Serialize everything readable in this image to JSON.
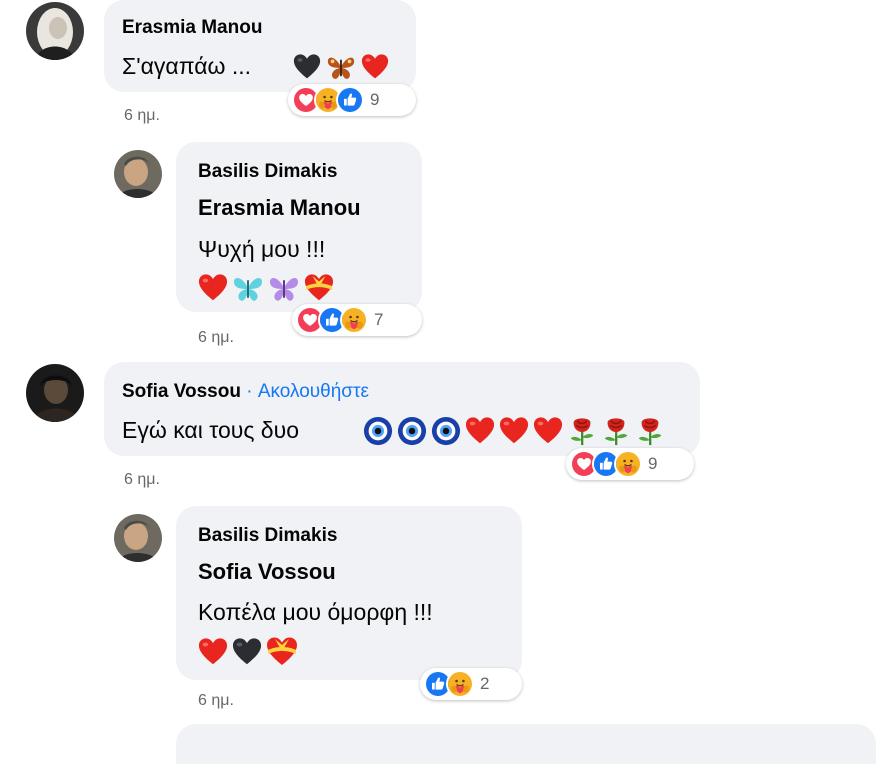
{
  "comments": [
    {
      "author": "Erasmia Manou",
      "text": "Σ'αγαπάω ...",
      "time": "6 ημ.",
      "emojis": [
        "black-heart-icon",
        "butterfly-icon",
        "red-heart-icon"
      ],
      "reactions": [
        "love-icon",
        "care-icon",
        "like-icon"
      ],
      "reaction_count": "9"
    },
    {
      "author": "Basilis Dimakis",
      "mention": "Erasmia Manou",
      "text": "Ψυχή μου !!!",
      "time": "6 ημ.",
      "emojis": [
        "red-heart-icon",
        "blue-butterfly-icon",
        "purple-butterfly-icon",
        "heart-with-ribbon-icon"
      ],
      "reactions": [
        "love-icon",
        "like-icon",
        "care-icon"
      ],
      "reaction_count": "7"
    },
    {
      "author": "Sofia Vossou",
      "follow_label": "· Ακολουθήστε",
      "text": "Εγώ και τους δυο",
      "time": "6 ημ.",
      "emojis": [
        "nazar-amulet-icon",
        "nazar-amulet-icon",
        "nazar-amulet-icon",
        "red-heart-icon",
        "red-heart-icon",
        "red-heart-icon",
        "rose-icon",
        "rose-icon",
        "rose-icon"
      ],
      "reactions": [
        "love-icon",
        "like-icon",
        "care-icon"
      ],
      "reaction_count": "9"
    },
    {
      "author": "Basilis Dimakis",
      "mention": "Sofia Vossou",
      "text": "Κοπέλα μου όμορφη !!!",
      "time": "6 ημ.",
      "emojis": [
        "red-heart-icon",
        "black-heart-icon",
        "heart-with-ribbon-icon"
      ],
      "reactions": [
        "like-icon",
        "care-icon"
      ],
      "reaction_count": "2"
    }
  ],
  "colors": {
    "bubble": "#f0f2f5",
    "link_blue": "#1877f2",
    "meta_gray": "#65676b",
    "love_red": "#f33e58",
    "like_blue": "#1877f2",
    "care_yellow": "#f7b125"
  }
}
